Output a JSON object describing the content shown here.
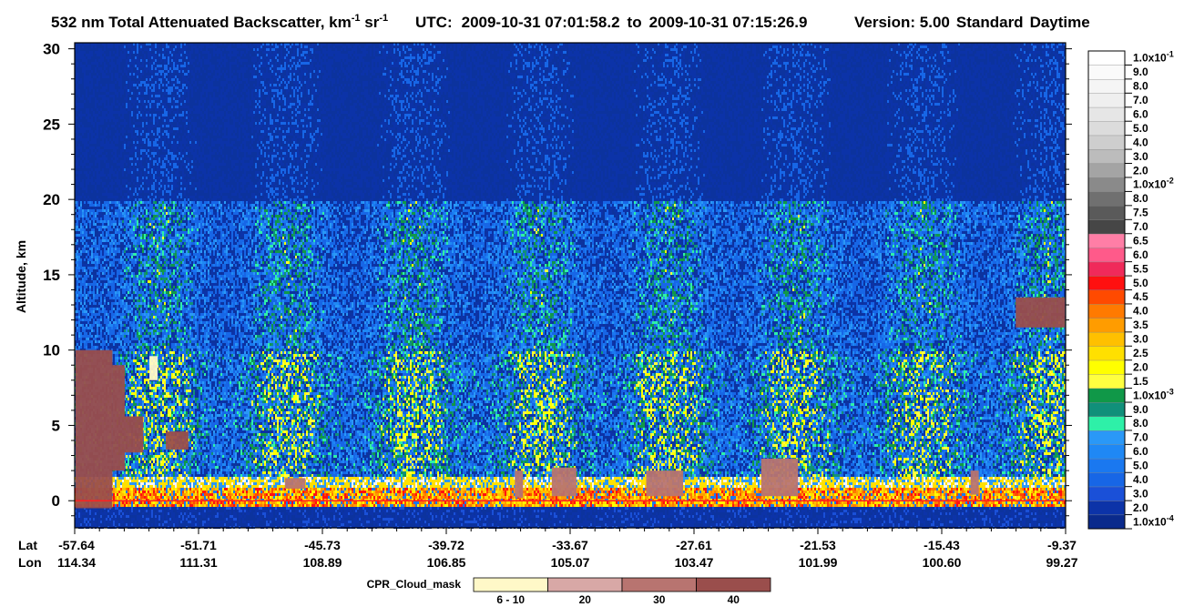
{
  "chart_data": {
    "type": "heatmap",
    "title": {
      "main": "532 nm Total Attenuated Backscatter, km",
      "sup1": "-1",
      "mid": " sr",
      "sup2": "-1",
      "utc_label": "UTC:",
      "start": "2009-10-31 07:01:58.2",
      "to": "to",
      "end": "2009-10-31 07:15:26.9",
      "version": "Version: 5.00",
      "mode": "Standard",
      "daytime": "Daytime"
    },
    "ylabel": "Altitude, km",
    "ylim": [
      -1.8,
      30.4
    ],
    "yticks": [
      "0",
      "5",
      "10",
      "15",
      "20",
      "25",
      "30"
    ],
    "ytick_values": [
      0,
      5,
      10,
      15,
      20,
      25,
      30
    ],
    "x_row_labels": [
      "Lat",
      "Lon"
    ],
    "x_ticks": [
      {
        "lat": "-57.64",
        "lon": "114.34"
      },
      {
        "lat": "-51.71",
        "lon": "111.31"
      },
      {
        "lat": "-45.73",
        "lon": "108.89"
      },
      {
        "lat": "-39.72",
        "lon": "106.85"
      },
      {
        "lat": "-33.67",
        "lon": "105.07"
      },
      {
        "lat": "-27.61",
        "lon": "103.47"
      },
      {
        "lat": "-21.53",
        "lon": "101.99"
      },
      {
        "lat": "-15.43",
        "lon": "100.60"
      },
      {
        "lat": "-9.37",
        "lon": "99.27"
      }
    ],
    "colorbar": [
      {
        "label": "1.0x10",
        "sup": "-4",
        "color": "#0a2a8c"
      },
      {
        "label": "2.0",
        "color": "#0c33a8"
      },
      {
        "label": "3.0",
        "color": "#1a50d8"
      },
      {
        "label": "4.0",
        "color": "#1766e6"
      },
      {
        "label": "5.0",
        "color": "#1a78f0"
      },
      {
        "label": "6.0",
        "color": "#1f88f5"
      },
      {
        "label": "7.0",
        "color": "#2a98f7"
      },
      {
        "label": "8.0",
        "color": "#2ef0a8"
      },
      {
        "label": "9.0",
        "color": "#10907a"
      },
      {
        "label": "1.0x10",
        "sup": "-3",
        "color": "#109848"
      },
      {
        "label": "1.5",
        "color": "#ffff40"
      },
      {
        "label": "2.0",
        "color": "#ffff00"
      },
      {
        "label": "2.5",
        "color": "#ffe000"
      },
      {
        "label": "3.0",
        "color": "#ffc000"
      },
      {
        "label": "3.5",
        "color": "#ff9c00"
      },
      {
        "label": "4.0",
        "color": "#ff7a00"
      },
      {
        "label": "4.5",
        "color": "#ff4a00"
      },
      {
        "label": "5.0",
        "color": "#ff1010"
      },
      {
        "label": "5.5",
        "color": "#f02a5a"
      },
      {
        "label": "6.0",
        "color": "#ff5a8a"
      },
      {
        "label": "6.5",
        "color": "#ff7ea6"
      },
      {
        "label": "7.0",
        "color": "#464646"
      },
      {
        "label": "7.5",
        "color": "#5a5a5a"
      },
      {
        "label": "8.0",
        "color": "#707070"
      },
      {
        "label": "1.0x10",
        "sup": "-2",
        "color": "#8a8a8a"
      },
      {
        "label": "2.0",
        "color": "#a4a4a4"
      },
      {
        "label": "3.0",
        "color": "#bcbcbc"
      },
      {
        "label": "4.0",
        "color": "#cecece"
      },
      {
        "label": "5.0",
        "color": "#dcdcdc"
      },
      {
        "label": "6.0",
        "color": "#e6e6e6"
      },
      {
        "label": "7.0",
        "color": "#efefef"
      },
      {
        "label": "8.0",
        "color": "#f5f5f5"
      },
      {
        "label": "9.0",
        "color": "#fafafa"
      },
      {
        "label": "1.0x10",
        "sup": "-1",
        "color": "#ffffff"
      }
    ],
    "cloud_mask": {
      "label": "CPR_Cloud_mask",
      "classes": [
        {
          "label": "6 - 10",
          "color": "#fff8c8"
        },
        {
          "label": "20",
          "color": "#d8a8a6"
        },
        {
          "label": "30",
          "color": "#b87470"
        },
        {
          "label": "40",
          "color": "#9a4e4c"
        }
      ]
    },
    "surface_line": {
      "altitude_km": 0,
      "color": "#ff2020"
    },
    "cloud_mask_regions": [
      {
        "lat_from": -57.6,
        "lat_to": -55.8,
        "alt_from": -0.5,
        "alt_to": 10.0,
        "cls": 3
      },
      {
        "lat_from": -55.8,
        "lat_to": -55.2,
        "alt_from": 2.0,
        "alt_to": 9.0,
        "cls": 3
      },
      {
        "lat_from": -55.2,
        "lat_to": -54.3,
        "alt_from": 3.2,
        "alt_to": 5.6,
        "cls": 3
      },
      {
        "lat_from": -53.2,
        "lat_to": -52.1,
        "alt_from": 3.4,
        "alt_to": 4.6,
        "cls": 3
      },
      {
        "lat_from": -54.0,
        "lat_to": -53.6,
        "alt_from": 8.0,
        "alt_to": 9.6,
        "cls": 0
      },
      {
        "lat_from": -11.8,
        "lat_to": -9.4,
        "alt_from": 11.5,
        "alt_to": 13.5,
        "cls": 3
      },
      {
        "lat_from": -47.4,
        "lat_to": -46.4,
        "alt_from": 0.8,
        "alt_to": 1.5,
        "cls": 2
      },
      {
        "lat_from": -36.2,
        "lat_to": -35.8,
        "alt_from": 0.2,
        "alt_to": 2.0,
        "cls": 2
      },
      {
        "lat_from": -34.4,
        "lat_to": -33.2,
        "alt_from": 0.3,
        "alt_to": 2.2,
        "cls": 2
      },
      {
        "lat_from": -29.8,
        "lat_to": -28.0,
        "alt_from": 0.3,
        "alt_to": 2.0,
        "cls": 2
      },
      {
        "lat_from": -24.2,
        "lat_to": -22.4,
        "alt_from": 0.3,
        "alt_to": 2.8,
        "cls": 2
      },
      {
        "lat_from": -14.0,
        "lat_to": -13.6,
        "alt_from": 0.4,
        "alt_to": 2.0,
        "cls": 2
      }
    ]
  }
}
